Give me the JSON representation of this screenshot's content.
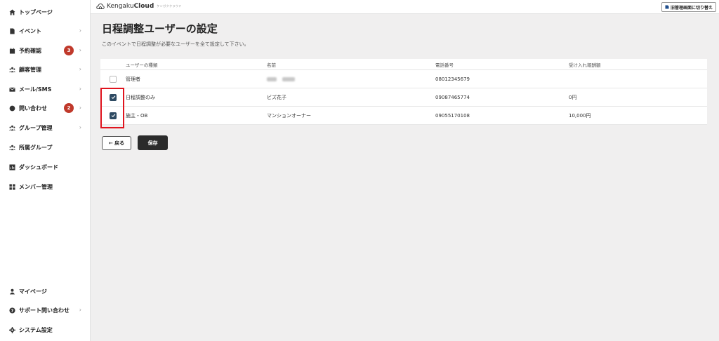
{
  "header": {
    "logo_prefix": "Kengaku",
    "logo_bold": "Cloud",
    "logo_sub": "ケンガククラウド",
    "switch_label": "旧管理画面に切り替え"
  },
  "sidebar": {
    "items": [
      {
        "label": "トップページ",
        "icon": "home-icon"
      },
      {
        "label": "イベント",
        "icon": "document-icon",
        "chevron": "›"
      },
      {
        "label": "予約確認",
        "icon": "calendar-icon",
        "badge": "3",
        "chevron": "›"
      },
      {
        "label": "顧客管理",
        "icon": "people-icon",
        "chevron": "›"
      },
      {
        "label": "メール/SMS",
        "icon": "mail-icon",
        "chevron": "›"
      },
      {
        "label": "問い合わせ",
        "icon": "chat-icon",
        "badge": "2",
        "chevron": "›"
      },
      {
        "label": "グループ管理",
        "icon": "group-icon",
        "chevron": "›"
      },
      {
        "label": "所属グループ",
        "icon": "group-icon"
      },
      {
        "label": "ダッシュボード",
        "icon": "chart-icon"
      },
      {
        "label": "メンバー管理",
        "icon": "grid-icon"
      }
    ],
    "bottom_items": [
      {
        "label": "マイページ",
        "icon": "user-icon"
      },
      {
        "label": "サポート問い合わせ",
        "icon": "help-icon",
        "chevron": "›"
      },
      {
        "label": "システム設定",
        "icon": "gear-icon"
      }
    ]
  },
  "main": {
    "title": "日程調整ユーザーの設定",
    "description": "このイベントで日程調整が必要なユーザーを全て設定して下さい。",
    "table": {
      "headers": [
        "ユーザーの種類",
        "名前",
        "電話番号",
        "受け入れ報酬額"
      ],
      "rows": [
        {
          "checked": false,
          "type": "管理者",
          "name": "",
          "name_blurred": true,
          "phone": "08012345679",
          "fee": ""
        },
        {
          "checked": true,
          "type": "日程調整のみ",
          "name": "ビズ花子",
          "phone": "09087465774",
          "fee": "0円"
        },
        {
          "checked": true,
          "type": "施主・OB",
          "name": "マンションオーナー",
          "phone": "09055170108",
          "fee": "10,000円"
        }
      ]
    },
    "back_label": "← 戻る",
    "save_label": "保存"
  },
  "colors": {
    "accent": "#2e4a62",
    "badge": "#c0392b",
    "highlight": "#e0141e",
    "save_button": "#2b2b2b"
  }
}
